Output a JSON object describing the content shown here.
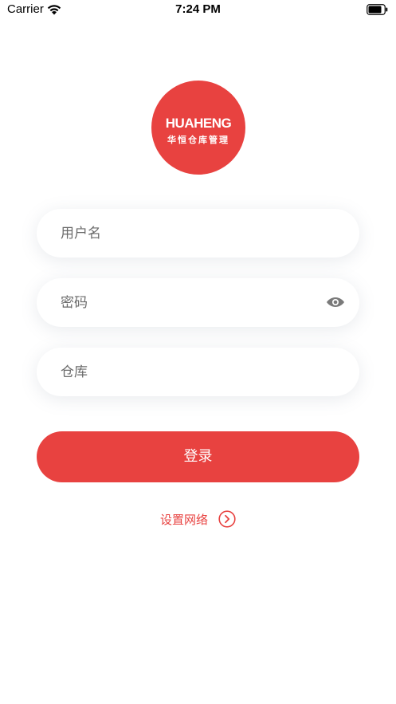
{
  "status_bar": {
    "carrier": "Carrier",
    "time": "7:24 PM",
    "wifi_icon": "wifi-icon",
    "battery_icon": "battery-icon"
  },
  "logo": {
    "brand": "HUAHENG",
    "subtitle": "华恒仓库管理",
    "color": "#e84240"
  },
  "form": {
    "username": {
      "placeholder": "用户名",
      "value": ""
    },
    "password": {
      "placeholder": "密码",
      "value": "",
      "toggle_icon": "eye-icon"
    },
    "warehouse": {
      "placeholder": "仓库",
      "value": ""
    }
  },
  "login_button": {
    "label": "登录",
    "color": "#e84240"
  },
  "network_link": {
    "label": "设置网络",
    "icon": "chevron-right-circle-icon"
  }
}
